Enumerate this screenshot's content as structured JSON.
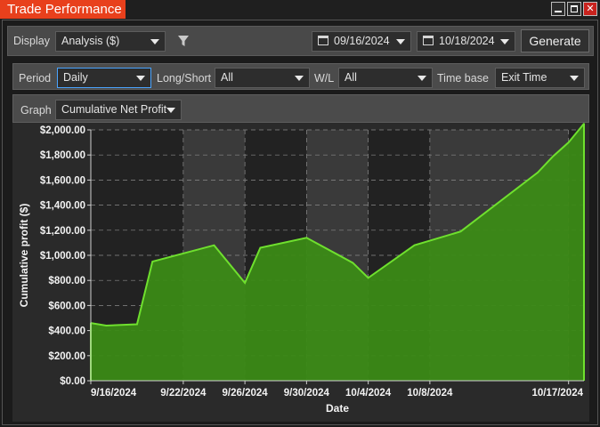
{
  "window": {
    "title": "Trade Performance"
  },
  "toolbar": {
    "display_label": "Display",
    "display_value": "Analysis ($)",
    "start_date": "09/16/2024",
    "end_date": "10/18/2024",
    "generate_label": "Generate"
  },
  "filters": {
    "period_label": "Period",
    "period_value": "Daily",
    "long_short_label": "Long/Short",
    "long_short_value": "All",
    "wl_label": "W/L",
    "wl_value": "All",
    "time_base_label": "Time base",
    "time_base_value": "Exit Time"
  },
  "graph": {
    "graph_label": "Graph",
    "graph_value": "Cumulative Net Profit"
  },
  "chart_data": {
    "type": "area",
    "xlabel": "Date",
    "ylabel": "Cumulative profit ($)",
    "ylim": [
      0,
      2000
    ],
    "y_ticks": [
      "$0.00",
      "$200.00",
      "$400.00",
      "$600.00",
      "$800.00",
      "$1,000.00",
      "$1,200.00",
      "$1,400.00",
      "$1,600.00",
      "$1,800.00",
      "$2,000.00"
    ],
    "x_ticks": [
      "9/16/2024",
      "9/22/2024",
      "9/26/2024",
      "9/30/2024",
      "10/4/2024",
      "10/8/2024",
      "10/17/2024"
    ],
    "grid": true,
    "colors": {
      "fill": "#3b8a16",
      "line": "#6fe02e",
      "band": "#3a3a3a",
      "plot": "#222222"
    },
    "series": [
      {
        "x": [
          "9/16/2024",
          "9/17/2024",
          "9/19/2024",
          "9/20/2024",
          "9/24/2024",
          "9/26/2024",
          "9/27/2024",
          "9/30/2024",
          "10/3/2024",
          "10/4/2024",
          "10/7/2024",
          "10/10/2024",
          "10/15/2024",
          "10/16/2024",
          "10/17/2024",
          "10/18/2024"
        ],
        "values": [
          460,
          440,
          450,
          950,
          1080,
          780,
          1060,
          1140,
          940,
          820,
          1080,
          1190,
          1660,
          1790,
          1900,
          2050
        ]
      }
    ]
  }
}
